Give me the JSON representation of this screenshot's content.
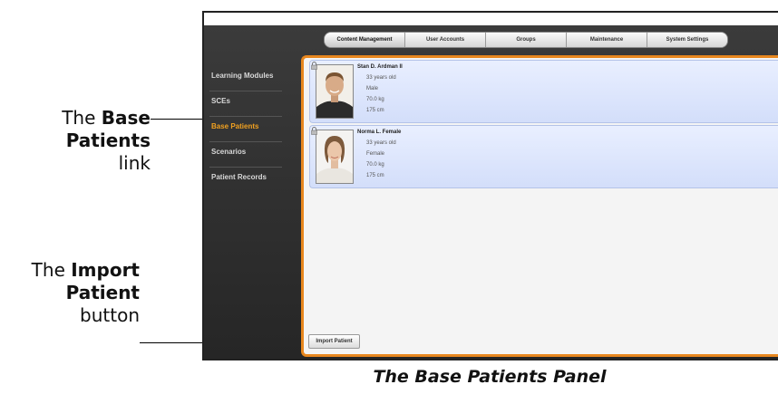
{
  "callouts": {
    "base_patients": {
      "prefix": "The ",
      "bold1": "Base",
      "bold2": "Patients",
      "suffix": "link"
    },
    "import_patient": {
      "prefix": "The ",
      "bold1": "Import",
      "bold2": "Patient",
      "suffix": "button"
    }
  },
  "caption": "The Base Patients Panel",
  "app": {
    "tabs": [
      "Content Management",
      "User Accounts",
      "Groups",
      "Maintenance",
      "System Settings"
    ],
    "active_tab": "Content Management",
    "sidebar": [
      "Learning Modules",
      "SCEs",
      "Base Patients",
      "Scenarios",
      "Patient Records"
    ],
    "active_sidebar": "Base Patients",
    "patients": [
      {
        "name": "Stan D. Ardman II",
        "age": "33 years old",
        "sex": "Male",
        "weight": "70.0 kg",
        "height": "175 cm",
        "avatar": "male-patient-icon"
      },
      {
        "name": "Norma L. Female",
        "age": "33 years old",
        "sex": "Female",
        "weight": "70.0 kg",
        "height": "175 cm",
        "avatar": "female-patient-icon"
      }
    ],
    "import_button": "Import Patient"
  },
  "colors": {
    "accent": "#e8871e",
    "active_sidebar": "#f0a020",
    "card_bg": "#dde6fd"
  }
}
